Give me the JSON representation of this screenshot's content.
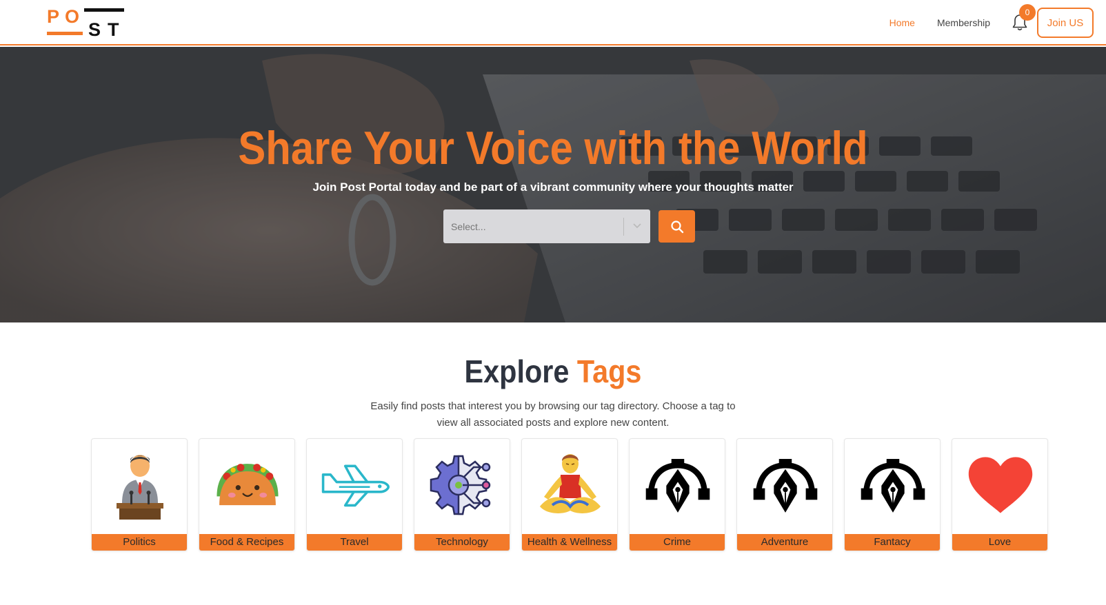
{
  "brand": {
    "logo_text": "POST",
    "accent": "#f37a2a"
  },
  "nav": {
    "links": [
      {
        "label": "Home",
        "active": true
      },
      {
        "label": "Membership",
        "active": false
      }
    ],
    "notifications_count": "0",
    "join_label": "Join US"
  },
  "hero": {
    "title": "Share Your Voice with the World",
    "subtitle": "Join Post Portal today and be part of a vibrant community where your thoughts matter",
    "search_placeholder": "Select..."
  },
  "explore": {
    "title_part1": "Explore",
    "title_part2": "Tags",
    "description": "Easily find posts that interest you by browsing our tag directory. Choose a tag to view all associated posts and explore new content.",
    "tags": [
      {
        "label": "Politics",
        "icon": "politician-icon"
      },
      {
        "label": "Food & Recipes",
        "icon": "taco-icon"
      },
      {
        "label": "Travel",
        "icon": "airplane-icon"
      },
      {
        "label": "Technology",
        "icon": "gear-circuit-icon"
      },
      {
        "label": "Health & Wellness",
        "icon": "meditation-icon"
      },
      {
        "label": "Crime",
        "icon": "pen-nib-icon"
      },
      {
        "label": "Adventure",
        "icon": "pen-nib-icon"
      },
      {
        "label": "Fantacy",
        "icon": "pen-nib-icon"
      },
      {
        "label": "Love",
        "icon": "heart-icon"
      }
    ]
  }
}
